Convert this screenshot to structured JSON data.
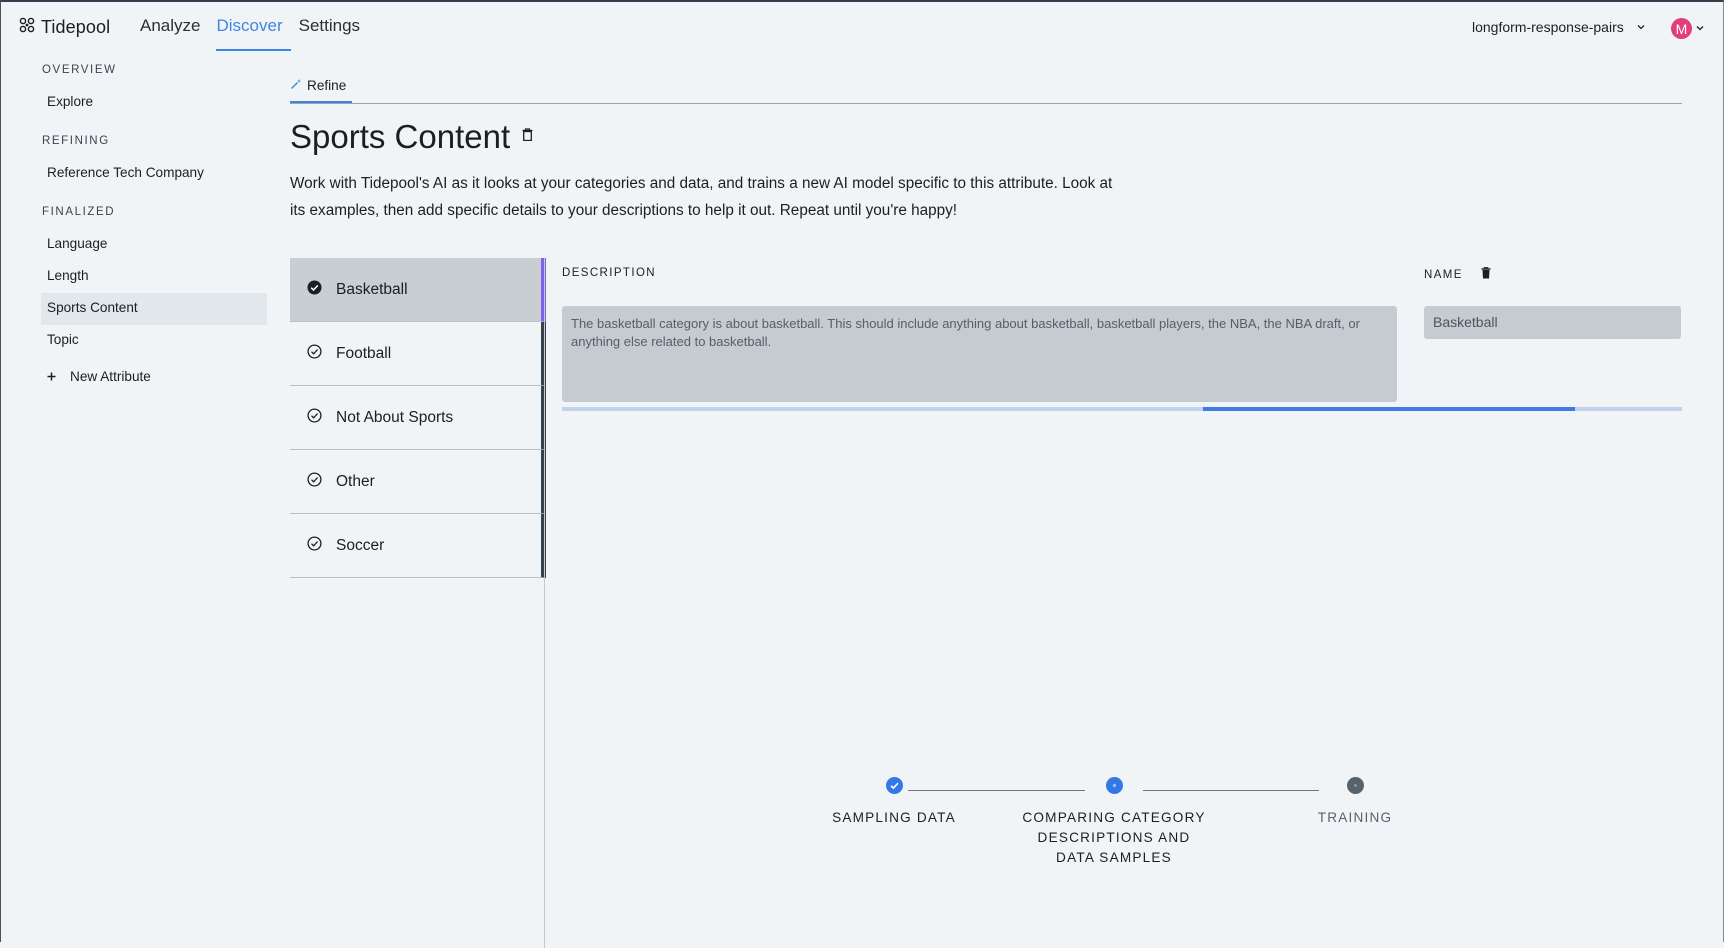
{
  "app": {
    "brand": "Tidepool",
    "nav": [
      "Analyze",
      "Discover",
      "Settings"
    ],
    "active_nav": "Discover",
    "dataset": "longform-response-pairs",
    "avatar_initial": "M",
    "avatar_color": "#e23e7a",
    "accent": "#3f86e0"
  },
  "sidebar": {
    "sections": [
      {
        "heading": "OVERVIEW",
        "items": [
          "Explore"
        ]
      },
      {
        "heading": "REFINING",
        "items": [
          "Reference Tech Company"
        ]
      },
      {
        "heading": "FINALIZED",
        "items": [
          "Language",
          "Length",
          "Sports Content",
          "Topic"
        ]
      }
    ],
    "active_item": "Sports Content",
    "new_attribute": "New Attribute"
  },
  "main": {
    "tab": "Refine",
    "title": "Sports Content",
    "intro": "Work with Tidepool's AI as it looks at your categories and data, and trains a new AI model specific to this attribute. Look at its examples, then add specific details to your descriptions to help it out. Repeat until you're happy!",
    "categories": [
      "Basketball",
      "Football",
      "Not About Sports",
      "Other",
      "Soccer"
    ],
    "active_category": "Basketball",
    "description_label": "DESCRIPTION",
    "name_label": "NAME",
    "description_value": "The basketball category is about basketball. This should include anything about basketball, basketball players, the NBA, the NBA draft, or anything else related to basketball.",
    "name_value": "Basketball",
    "steps": [
      {
        "label": "SAMPLING DATA",
        "state": "done"
      },
      {
        "label": "COMPARING CATEGORY DESCRIPTIONS AND DATA SAMPLES",
        "state": "current"
      },
      {
        "label": "TRAINING",
        "state": "pending"
      }
    ]
  }
}
